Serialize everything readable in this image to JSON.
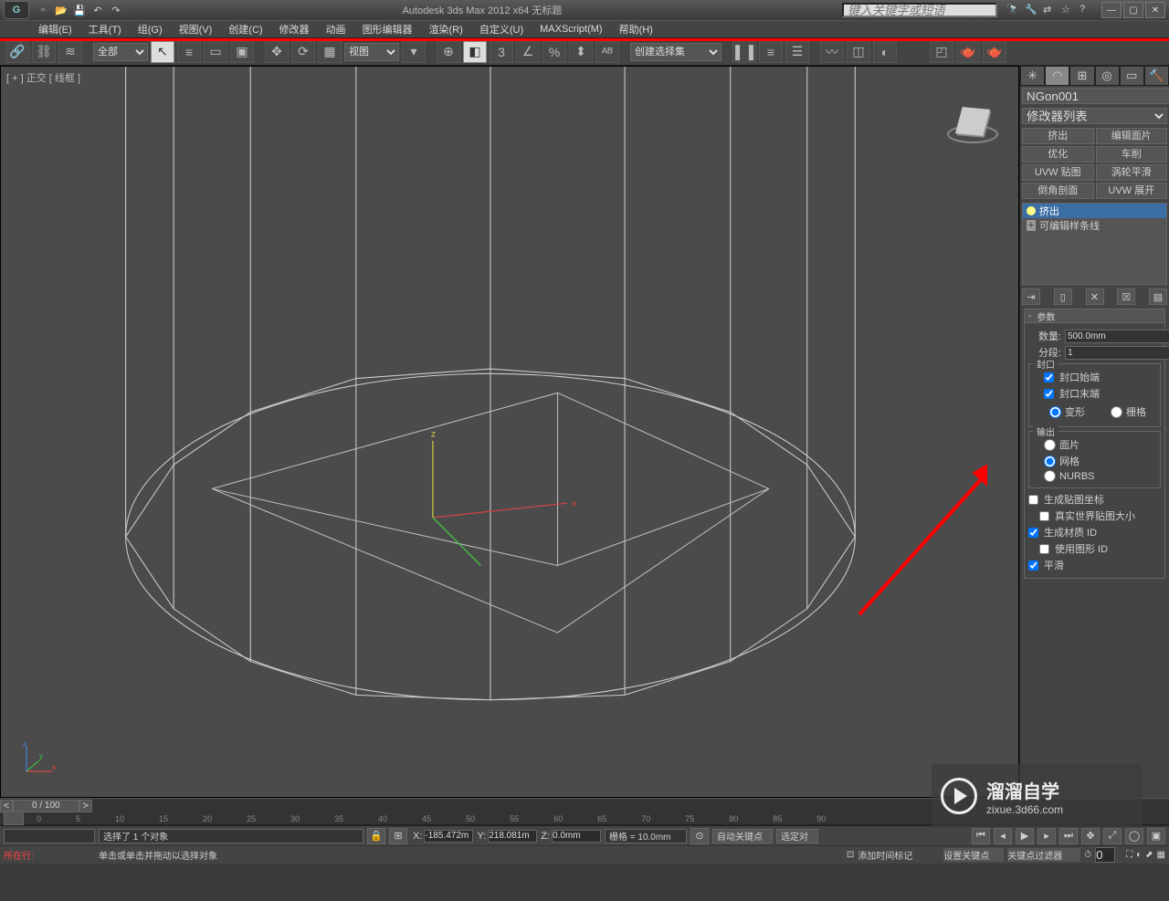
{
  "title": "Autodesk 3ds Max  2012 x64     无标题",
  "searchPlaceholder": "键入关键字或短语",
  "menu": [
    "编辑(E)",
    "工具(T)",
    "组(G)",
    "视图(V)",
    "创建(C)",
    "修改器",
    "动画",
    "图形编辑器",
    "渲染(R)",
    "自定义(U)",
    "MAXScript(M)",
    "帮助(H)"
  ],
  "toolbar": {
    "filterAll": "全部",
    "viewCombo": "视图",
    "selSetCombo": "创建选择集"
  },
  "viewport": {
    "label": "[ + ] 正交 [ 线框 ]"
  },
  "panel": {
    "objectName": "NGon001",
    "modListLabel": "修改器列表",
    "quickBtns": [
      "挤出",
      "编辑面片",
      "优化",
      "车削",
      "UVW 贴图",
      "涡轮平滑",
      "倒角剖面",
      "UVW 展开"
    ],
    "stack": [
      "挤出",
      "可编辑样条线"
    ],
    "rolloutTitle": "参数",
    "amountLabel": "数量:",
    "amountValue": "500.0mm",
    "segLabel": "分段:",
    "segValue": "1",
    "capGroup": "封口",
    "capStart": "封口始端",
    "capEnd": "封口末端",
    "morph": "变形",
    "grid": "栅格",
    "outputGroup": "输出",
    "outPatch": "面片",
    "outMesh": "网格",
    "outNurbs": "NURBS",
    "genMap": "生成贴图坐标",
    "realWorld": "真实世界贴图大小",
    "genMatID": "生成材质 ID",
    "useShapeID": "使用图形 ID",
    "smooth": "平滑"
  },
  "timeline": {
    "pos": "0 / 100",
    "ticks": [
      "0",
      "5",
      "10",
      "15",
      "20",
      "25",
      "30",
      "35",
      "40",
      "45",
      "50",
      "55",
      "60",
      "65",
      "70",
      "75",
      "80",
      "85",
      "90"
    ]
  },
  "status": {
    "selected": "选择了 1 个对象",
    "x": "-185.472m",
    "y": "218.081m",
    "z": "0.0mm",
    "grid": "栅格 = 10.0mm",
    "autokey": "自动关键点",
    "selOnly": "选定对",
    "prompt": "单击或单击并拖动以选择对象",
    "addTime": "添加时间标记",
    "setKey": "设置关键点",
    "keyFilter": "关键点过滤器",
    "curTask": "所在行:"
  },
  "watermark": {
    "cn": "溜溜自学",
    "url": "zixue.3d66.com"
  },
  "chart_data": {
    "type": "table",
    "title": "挤出 参数",
    "rows": [
      {
        "label": "数量",
        "value": "500.0mm"
      },
      {
        "label": "分段",
        "value": "1"
      }
    ]
  }
}
